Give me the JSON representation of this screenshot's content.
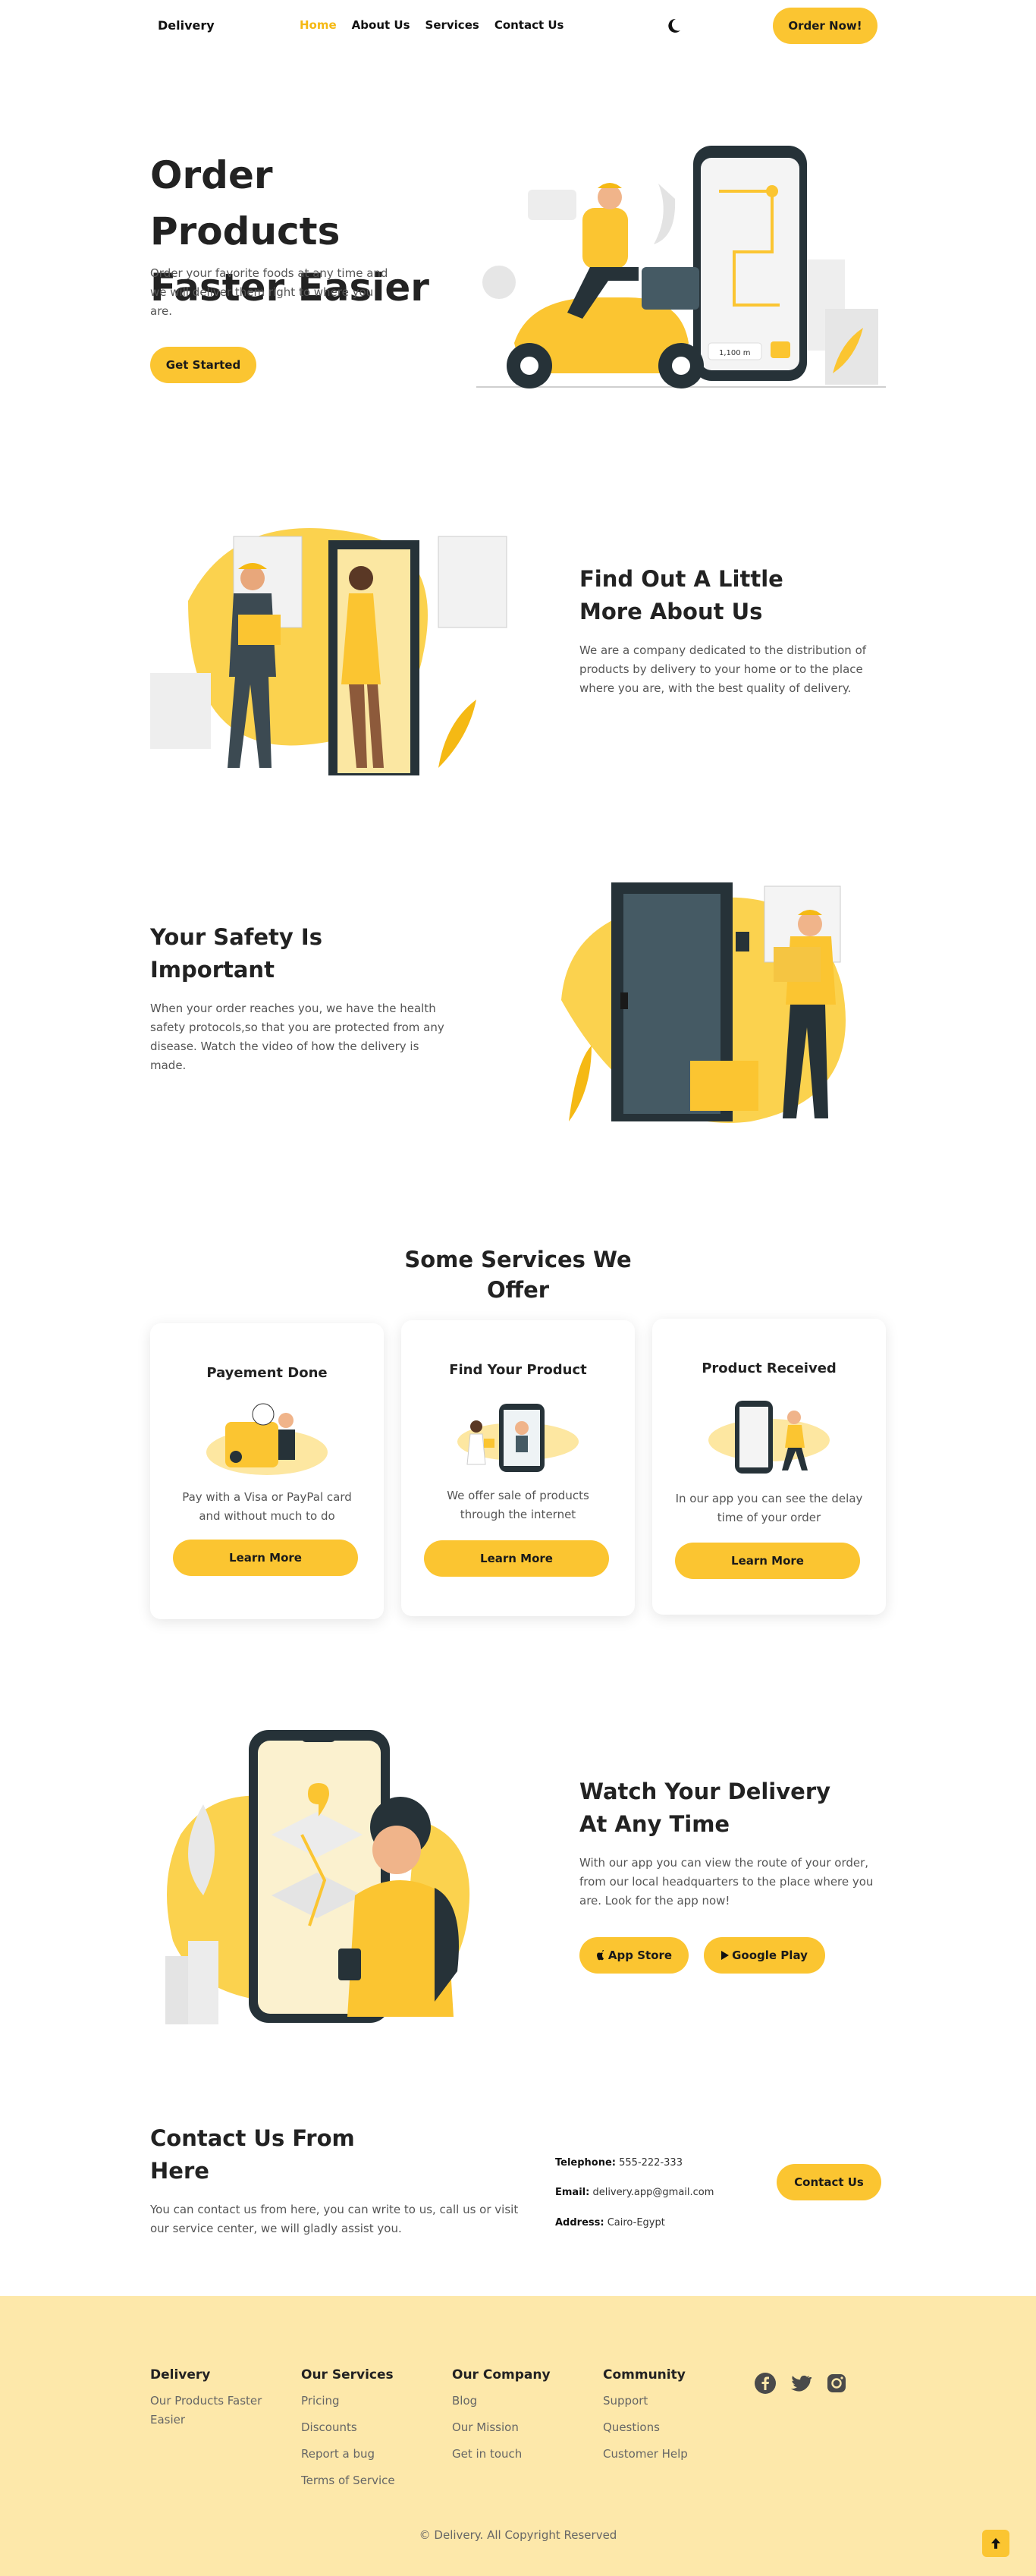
{
  "nav": {
    "logo": "Delivery",
    "links": [
      "Home",
      "About Us",
      "Services",
      "Contact Us"
    ],
    "order_label": "Order Now!",
    "theme_icon": "moon-icon"
  },
  "hero": {
    "title": "Order Products Faster Easier",
    "text": "Order your favorite foods at any time and we will deliver them right to where you are.",
    "button": "Get Started",
    "map_label": "1,100 m"
  },
  "about": {
    "title": "Find Out A Little More About Us",
    "text": "We are a company dedicated to the distribution of products by delivery to your home or to the place where you are, with the best quality of delivery."
  },
  "safety": {
    "title": "Your Safety Is Important",
    "text": "When your order reaches you, we have the health safety protocols,so that you are protected from any disease. Watch the video of how the delivery is made."
  },
  "services": {
    "title": "Some Services We Offer",
    "cards": [
      {
        "title": "Payement Done",
        "text": "Pay with a Visa or PayPal card and without much to do",
        "button": "Learn More"
      },
      {
        "title": "Find Your Product",
        "text": "We offer sale of products through the internet",
        "button": "Learn More"
      },
      {
        "title": "Product Received",
        "text": "In our app you can see the delay time of your order",
        "button": "Learn More"
      }
    ]
  },
  "watch": {
    "title": "Watch Your Delivery At Any Time",
    "text": "With our app you can view the route of your order, from our local headquarters to the place where you are. Look for the app now!",
    "app_store": "App Store",
    "google_play": "Google Play"
  },
  "contact": {
    "title": "Contact Us From Here",
    "text": "You can contact us from here, you can write to us, call us or visit our service center, we will gladly assist you.",
    "telephone_label": "Telephone:",
    "telephone": "555-222-333",
    "email_label": "Email:",
    "email": "delivery.app@gmail.com",
    "address_label": "Address:",
    "address": "Cairo-Egypt",
    "button": "Contact Us"
  },
  "footer": {
    "columns": [
      {
        "title": "Delivery",
        "links": [
          "Our Products Faster Easier"
        ]
      },
      {
        "title": "Our Services",
        "links": [
          "Pricing",
          "Discounts",
          "Report a bug",
          "Terms of Service"
        ]
      },
      {
        "title": "Our Company",
        "links": [
          "Blog",
          "Our Mission",
          "Get in touch"
        ]
      },
      {
        "title": "Community",
        "links": [
          "Support",
          "Questions",
          "Customer Help"
        ]
      }
    ],
    "social": [
      "facebook-icon",
      "twitter-icon",
      "instagram-icon"
    ],
    "copyright": "© Delivery. All Copyright Reserved"
  },
  "colors": {
    "accent": "#fbc531",
    "footer_bg": "#fde8aa",
    "dark": "#263238"
  }
}
